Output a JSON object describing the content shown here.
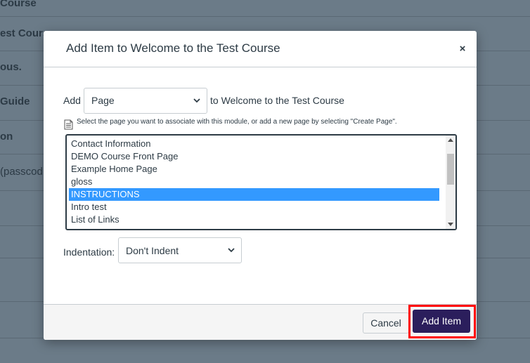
{
  "background": {
    "rows": [
      {
        "text": "Course"
      },
      {
        "text": "est Cours"
      },
      {
        "text": "ous."
      },
      {
        "text": "Guide"
      },
      {
        "text": "on"
      },
      {
        "text": "(passcod"
      }
    ]
  },
  "modal": {
    "title": "Add Item to Welcome to the Test Course",
    "close_glyph": "×",
    "add_label": "Add",
    "item_type_value": "Page",
    "to_label": "to Welcome to the Test Course",
    "hint": "Select the page you want to associate with this module, or add a new page by selecting \"Create Page\".",
    "pages": [
      "Contact Information",
      "DEMO Course Front Page",
      "Example Home Page",
      "gloss",
      "INSTRUCTIONS",
      "Intro test",
      "List of Links"
    ],
    "selected_page": "INSTRUCTIONS",
    "indentation_label": "Indentation:",
    "indentation_value": "Don't Indent",
    "cancel_label": "Cancel",
    "add_item_label": "Add Item"
  },
  "colors": {
    "primary_button": "#2b1e5c",
    "selection": "#3399ff",
    "highlight": "#ff0000"
  }
}
